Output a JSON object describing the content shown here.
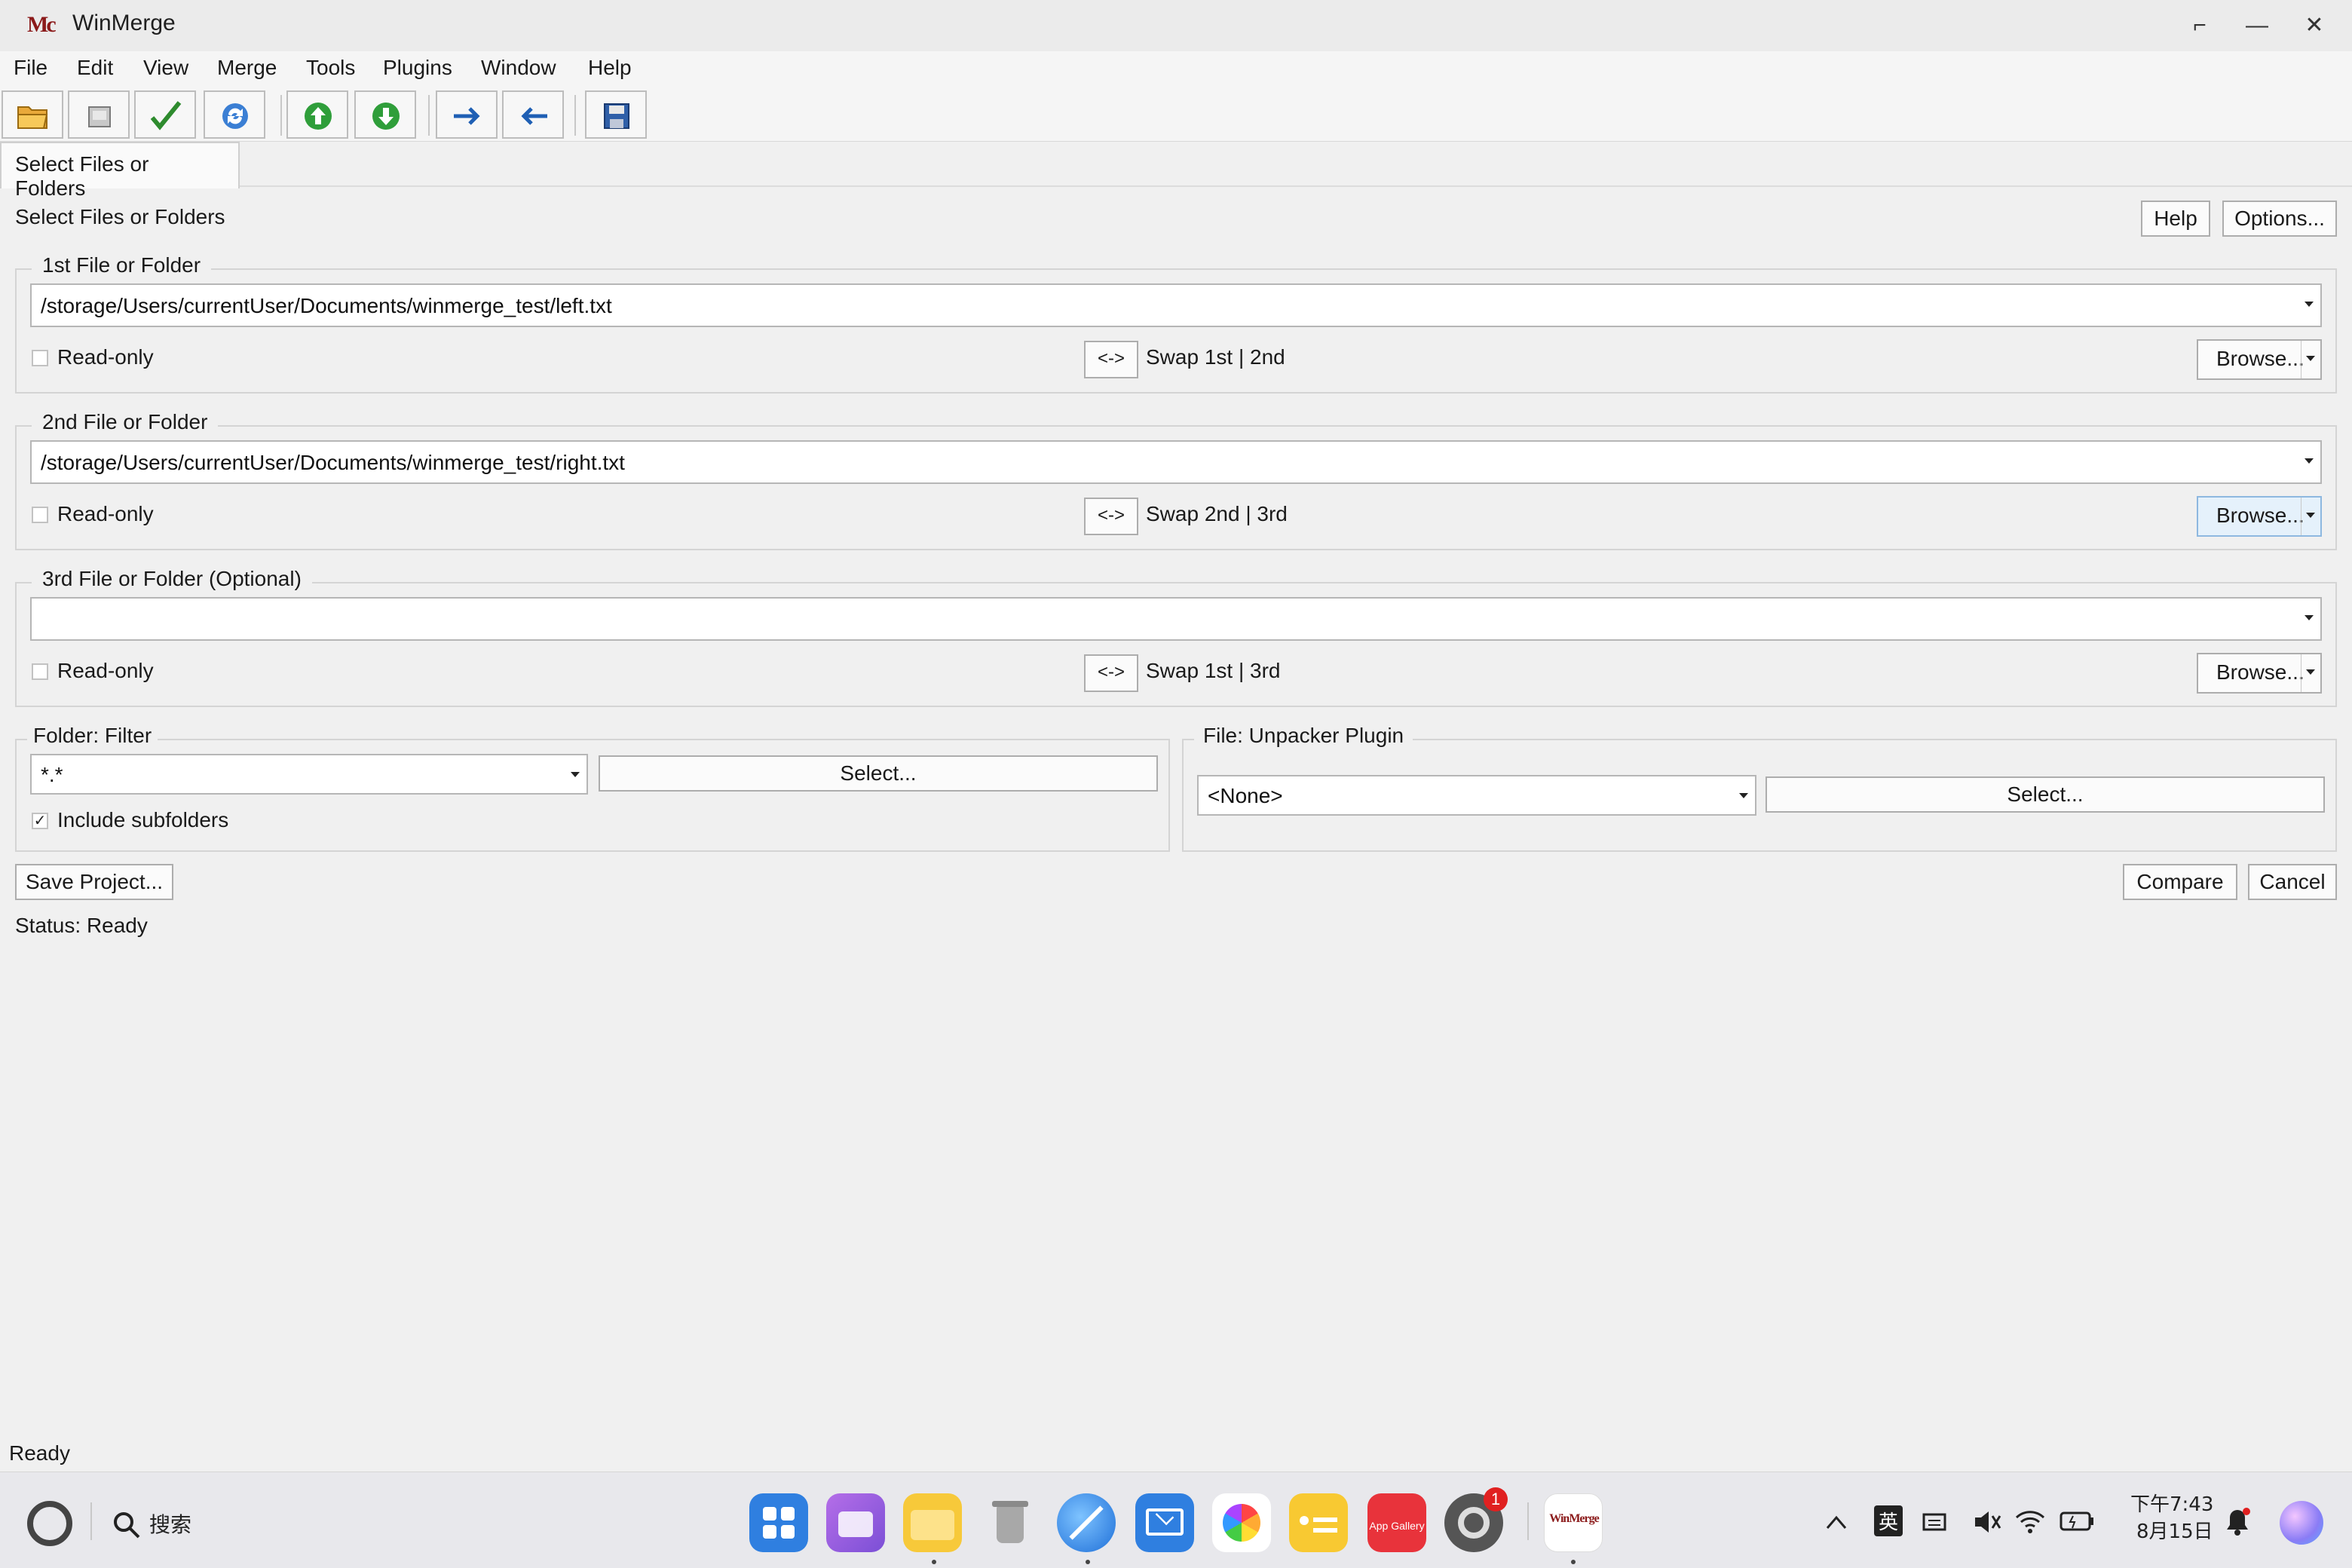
{
  "window": {
    "title": "WinMerge",
    "logo_text": "Mc",
    "controls": {
      "restore": "⌐",
      "minimize": "—",
      "close": "✕"
    }
  },
  "menu": [
    "File",
    "Edit",
    "View",
    "Merge",
    "Tools",
    "Plugins",
    "Window",
    "Help"
  ],
  "toolbar": {
    "icons": [
      "open-folder-icon",
      "device-icon",
      "checkmark-icon",
      "refresh-icon",
      "arrow-up-circle-icon",
      "arrow-down-circle-icon",
      "arrow-right-icon",
      "arrow-left-icon",
      "save-disk-icon"
    ]
  },
  "tab": {
    "label": "Select Files or Folders"
  },
  "header": {
    "title": "Select Files or Folders",
    "help": "Help",
    "options": "Options..."
  },
  "first": {
    "title": "1st File or Folder",
    "path": "/storage/Users/currentUser/Documents/winmerge_test/left.txt",
    "readonly": "Read-only",
    "swap_btn": "<->",
    "swap_label": "Swap 1st | 2nd",
    "browse": "Browse..."
  },
  "second": {
    "title": "2nd File or Folder",
    "path": "/storage/Users/currentUser/Documents/winmerge_test/right.txt",
    "readonly": "Read-only",
    "swap_btn": "<->",
    "swap_label": "Swap 2nd | 3rd",
    "browse": "Browse..."
  },
  "third": {
    "title": "3rd File or Folder (Optional)",
    "path": "",
    "readonly": "Read-only",
    "swap_btn": "<->",
    "swap_label": "Swap 1st | 3rd",
    "browse": "Browse..."
  },
  "filter": {
    "title": "Folder: Filter",
    "value": "*.*",
    "select": "Select...",
    "include_subfolders": "Include subfolders",
    "check_mark": "✓"
  },
  "unpacker": {
    "title": "File: Unpacker Plugin",
    "value": "<None>",
    "select": "Select..."
  },
  "actions": {
    "save_project": "Save Project...",
    "compare": "Compare",
    "cancel": "Cancel"
  },
  "status": {
    "line": "Status: Ready",
    "bottom": "Ready"
  },
  "taskbar": {
    "search": "搜索",
    "notification_badge": "1",
    "app_gallery_text": "App Gallery",
    "winmerge_text": "WinMerge",
    "ime": "英",
    "time": "下午7:43",
    "date": "8月15日"
  },
  "colors": {
    "accent": "#2f7fe0",
    "titlebar": "#ebebeb",
    "window_bg": "#f0f0f0",
    "logo": "#8b1a1a"
  }
}
